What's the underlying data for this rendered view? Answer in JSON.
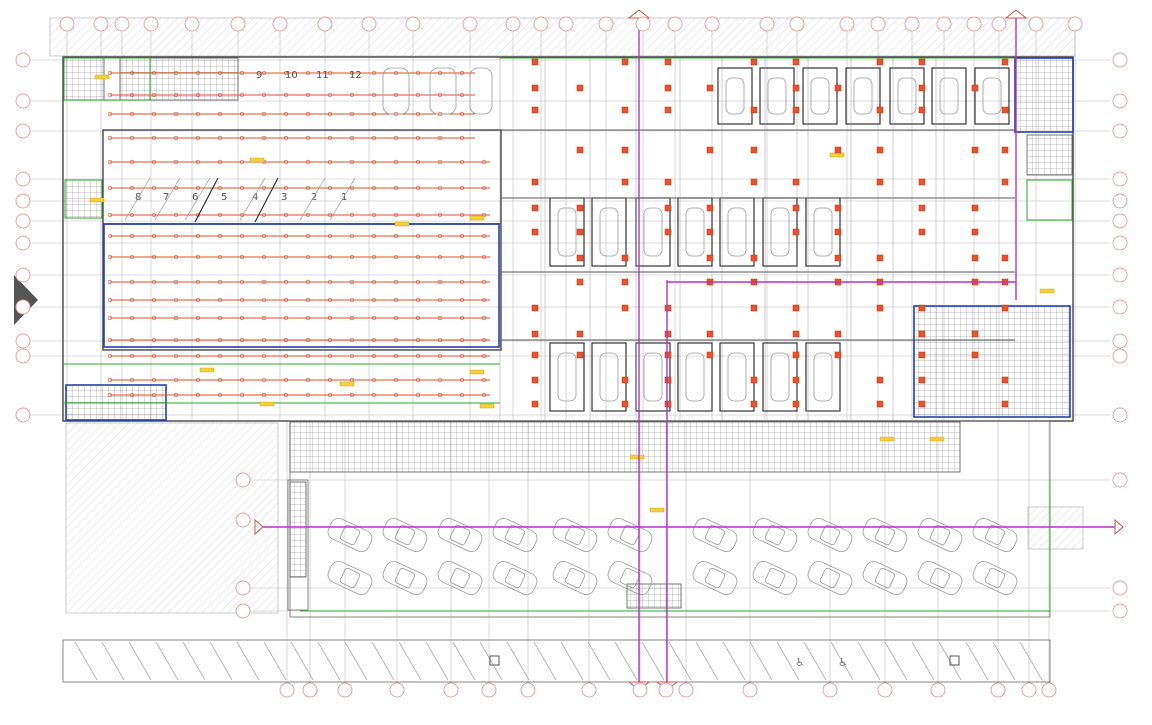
{
  "drawing": {
    "type": "reflected ceiling / lighting floor plan",
    "stall_numbers_row_top": [
      "9",
      "10",
      "11",
      "12"
    ],
    "stall_numbers_row_mid": [
      "8",
      "7",
      "6",
      "5",
      "4",
      "3",
      "2",
      "1"
    ]
  },
  "colors": {
    "walls": "#444444",
    "lighting_runs": "#d9502b",
    "fixtures": "#e8532a",
    "partitions_blue": "#2740a8",
    "partitions_green": "#2da62d",
    "section_lines": "#b333c9",
    "grid_bubbles": "#e8a0a0"
  },
  "icons": [
    "grid-bubble-icon",
    "section-marker-icon",
    "car-icon",
    "light-fixture-icon",
    "north-arrow-icon",
    "accessible-parking-icon"
  ]
}
